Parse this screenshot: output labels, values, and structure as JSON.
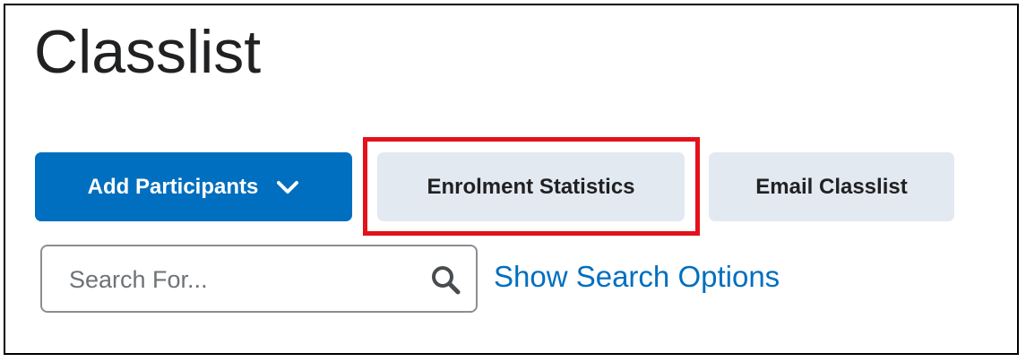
{
  "page": {
    "title": "Classlist"
  },
  "toolbar": {
    "add_participants_label": "Add Participants",
    "add_participants_icon": "chevron-down-icon",
    "enrolment_statistics_label": "Enrolment Statistics",
    "email_classlist_label": "Email Classlist"
  },
  "search": {
    "placeholder": "Search For...",
    "value": "",
    "icon": "search-icon",
    "options_link_label": "Show Search Options"
  },
  "colors": {
    "primary": "#006fbf",
    "secondary_button": "#e3e9f1",
    "highlight": "#e3121b",
    "text": "#202122",
    "link": "#006fbf"
  }
}
